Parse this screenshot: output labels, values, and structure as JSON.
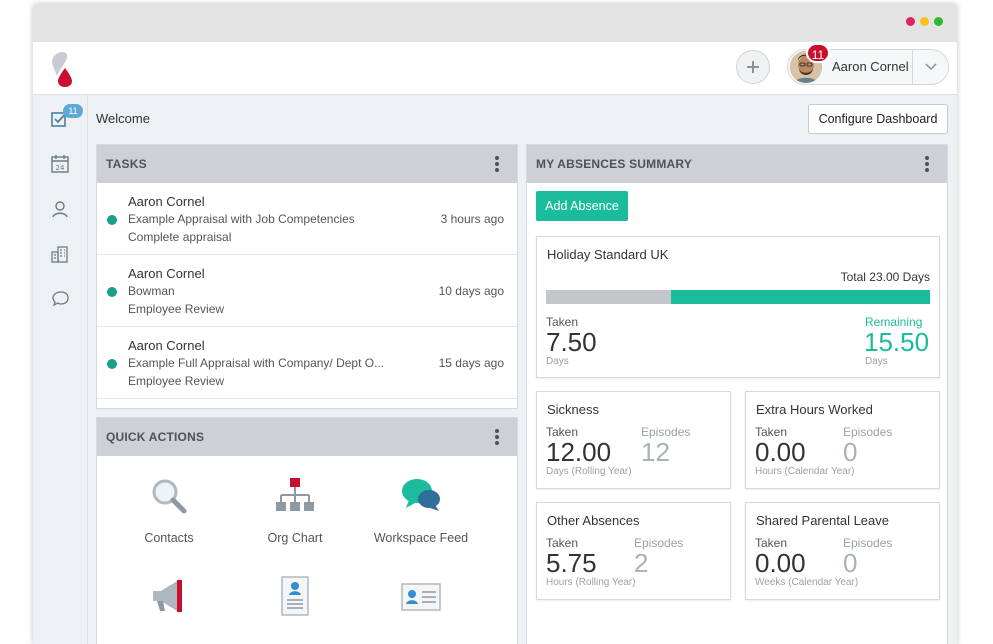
{
  "colors": {
    "accent": "#1abc9c",
    "brand_red": "#c8102e",
    "header_grey": "#cdd1d6",
    "badge_blue": "#5fa9d6"
  },
  "header": {
    "user_name": "Aaron Cornel",
    "notification_count": "11",
    "add_icon": "plus-icon",
    "menu_icon": "chevron-down-icon"
  },
  "sidebar": {
    "items": [
      {
        "icon": "tasks-checkbox-icon",
        "badge": "11"
      },
      {
        "icon": "calendar-icon",
        "date": "24"
      },
      {
        "icon": "person-icon"
      },
      {
        "icon": "building-icon"
      },
      {
        "icon": "chat-icon"
      }
    ]
  },
  "main": {
    "welcome": "Welcome",
    "configure_label": "Configure Dashboard"
  },
  "tasks": {
    "title": "TASKS",
    "items": [
      {
        "name": "Aaron Cornel",
        "desc": "Example Appraisal with Job Competencies",
        "sub": "Complete appraisal",
        "time": "3 hours ago"
      },
      {
        "name": "Aaron Cornel",
        "desc": "Bowman",
        "sub": "Employee Review",
        "time": "10 days ago"
      },
      {
        "name": "Aaron Cornel",
        "desc": "Example Full Appraisal with Company/ Dept O...",
        "sub": "Employee Review",
        "time": "15 days ago"
      }
    ]
  },
  "quick_actions": {
    "title": "QUICK ACTIONS",
    "items": [
      {
        "label": "Contacts",
        "icon": "magnifier-icon"
      },
      {
        "label": "Org Chart",
        "icon": "org-chart-icon"
      },
      {
        "label": "Workspace Feed",
        "icon": "speech-bubbles-icon"
      },
      {
        "label": "",
        "icon": "megaphone-icon"
      },
      {
        "label": "",
        "icon": "document-person-icon"
      },
      {
        "label": "",
        "icon": "id-card-icon"
      }
    ]
  },
  "absences": {
    "title": "MY ABSENCES SUMMARY",
    "add_label": "Add Absence",
    "holiday": {
      "title": "Holiday Standard UK",
      "total": "Total 23.00 Days",
      "taken_label": "Taken",
      "taken_value": "7.50",
      "taken_unit": "Days",
      "remaining_label": "Remaining",
      "remaining_value": "15.50",
      "remaining_unit": "Days",
      "taken_fraction": 0.326
    },
    "cards": [
      {
        "title": "Sickness",
        "taken_label": "Taken",
        "taken_value": "12.00",
        "episodes_label": "Episodes",
        "episodes_value": "12",
        "unit": "Days (Rolling Year)"
      },
      {
        "title": "Extra Hours Worked",
        "taken_label": "Taken",
        "taken_value": "0.00",
        "episodes_label": "Episodes",
        "episodes_value": "0",
        "unit": "Hours (Calendar Year)"
      },
      {
        "title": "Other Absences",
        "taken_label": "Taken",
        "taken_value": "5.75",
        "episodes_label": "Episodes",
        "episodes_value": "2",
        "unit": "Hours (Rolling Year)"
      },
      {
        "title": "Shared Parental Leave",
        "taken_label": "Taken",
        "taken_value": "0.00",
        "episodes_label": "Episodes",
        "episodes_value": "0",
        "unit": "Weeks (Calendar Year)"
      }
    ]
  }
}
